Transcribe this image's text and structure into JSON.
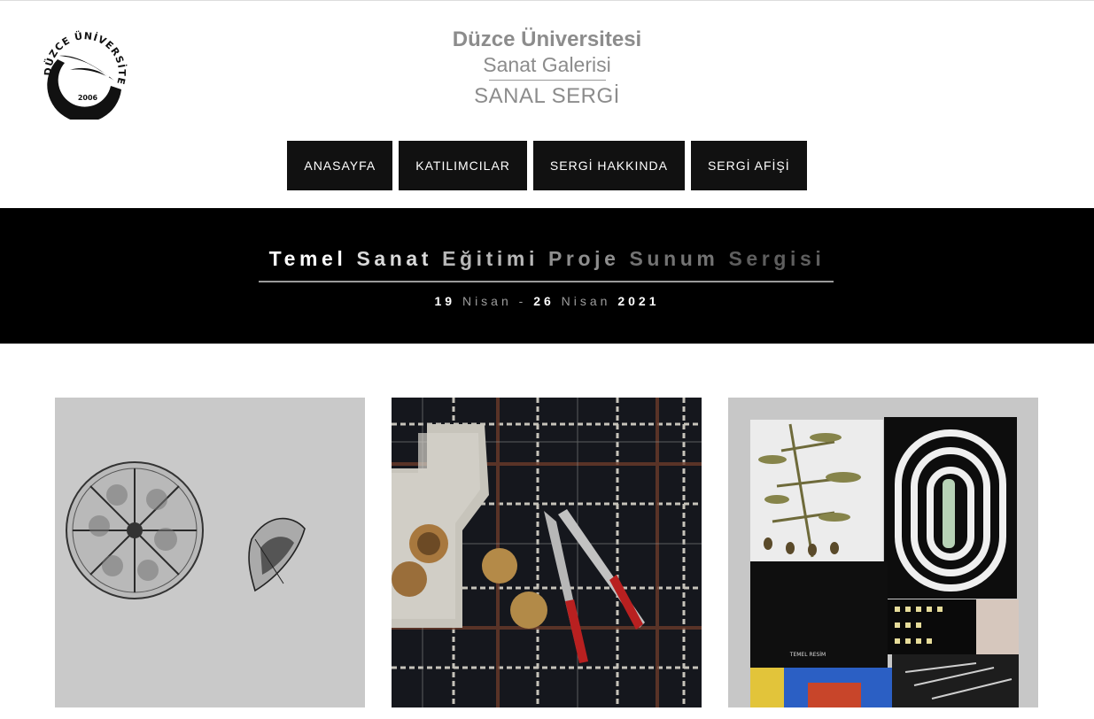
{
  "header": {
    "logo": {
      "icon": "university-logo",
      "ring_text": "DÜZCE ÜNİVERSİTESİ",
      "year": "2006"
    },
    "university": "Düzce Üniversitesi",
    "gallery": "Sanat Galerisi",
    "subtitle": "SANAL SERGİ"
  },
  "nav": {
    "items": [
      "ANASAYFA",
      "KATILIMCILAR",
      "SERGİ HAKKINDA",
      "SERGİ AFİŞİ"
    ]
  },
  "banner": {
    "title_words": [
      "Temel",
      "Sanat",
      "Eğitimi",
      "Proje",
      "Sunum",
      "Sergisi"
    ],
    "date_parts": [
      "19",
      "Nisan",
      "-",
      "26",
      "Nisan",
      "2021"
    ],
    "colors": {
      "background": "#000000",
      "title": "#ffffff"
    }
  },
  "gallery": {
    "artworks": [
      {
        "icon": "artwork-orange-slice-drawing"
      },
      {
        "icon": "artwork-walnut-nutcracker-still-life"
      },
      {
        "icon": "artwork-collage",
        "label": "TEMEL RESİM"
      }
    ]
  }
}
